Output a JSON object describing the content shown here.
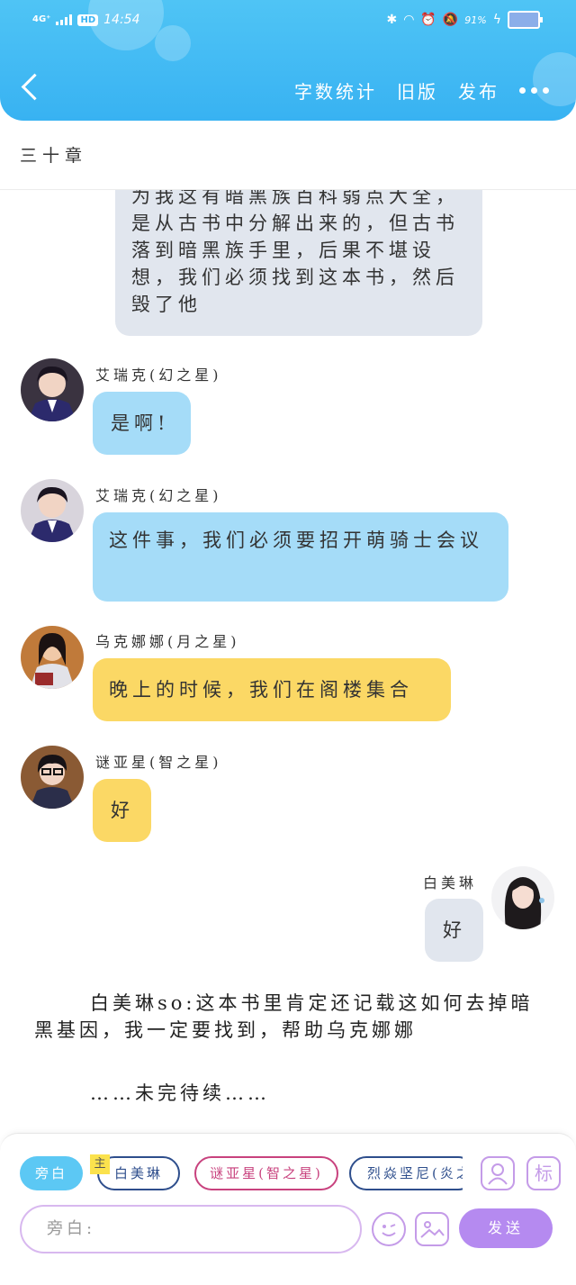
{
  "status_bar": {
    "network": "4G⁺",
    "hd": "HD",
    "time": "14:54",
    "battery": "91%"
  },
  "header": {
    "actions": [
      "字数统计",
      "旧版",
      "发布"
    ]
  },
  "chapter": {
    "title": "三十章"
  },
  "chat": {
    "messages": [
      {
        "type": "narration-bubble",
        "color": "#e1e6ee",
        "text": "为我这有暗黑族百科弱点大全，是从古书中分解出来的，但古书落到暗黑族手里，后果不堪设想，我们必须找到这本书，然后毁了他"
      },
      {
        "type": "left",
        "speaker": "艾瑞克(幻之星)",
        "color": "#a5dcf8",
        "text": "是啊!"
      },
      {
        "type": "left",
        "speaker": "艾瑞克(幻之星)",
        "color": "#a5dcf8",
        "text": "这件事，我们必须要招开萌骑士会议"
      },
      {
        "type": "left",
        "speaker": "乌克娜娜(月之星)",
        "color": "#fbd865",
        "text": "晚上的时候，我们在阁楼集合"
      },
      {
        "type": "left",
        "speaker": "谜亚星(智之星)",
        "color": "#fbd865",
        "text": "好"
      },
      {
        "type": "right",
        "speaker": "白美琳",
        "color": "#e1e6ee",
        "text": "好"
      }
    ],
    "narration": [
      "白美琳so:这本书里肯定还记载这如何去掉暗黑基因，我一定要找到，帮助乌克娜娜",
      "……未完待续……"
    ]
  },
  "bottom": {
    "chips": {
      "narration": "旁白",
      "main_tag": "主",
      "main": "白美琳",
      "mi": "谜亚星(智之星)",
      "lie": "烈焱坚尼(炎之星)"
    },
    "side_icon_label": "标",
    "input_placeholder": "旁白:",
    "send_label": "发送"
  },
  "colors": {
    "header": "#3ab4f2",
    "bubble_gray": "#e1e6ee",
    "bubble_blue": "#a5dcf8",
    "bubble_yellow": "#fbd865",
    "accent_purple": "#b58af0"
  }
}
